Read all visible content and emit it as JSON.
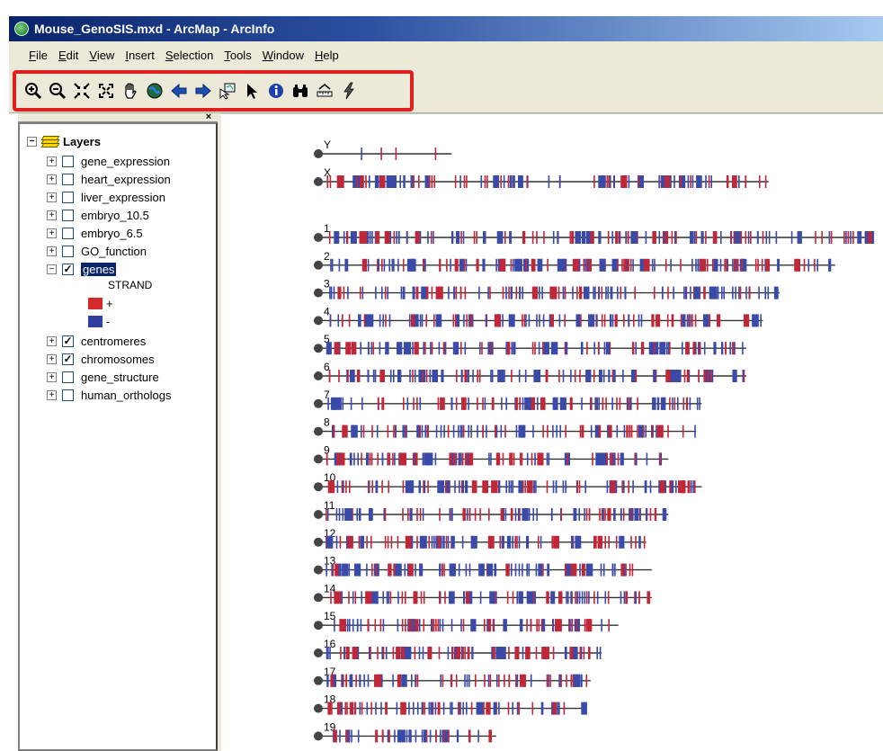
{
  "window": {
    "title": "Mouse_GenoSIS.mxd - ArcMap - ArcInfo"
  },
  "menu": [
    {
      "label": "File",
      "hot": "F"
    },
    {
      "label": "Edit",
      "hot": "E"
    },
    {
      "label": "View",
      "hot": "V"
    },
    {
      "label": "Insert",
      "hot": "I"
    },
    {
      "label": "Selection",
      "hot": "S"
    },
    {
      "label": "Tools",
      "hot": "T"
    },
    {
      "label": "Window",
      "hot": "W"
    },
    {
      "label": "Help",
      "hot": "H"
    }
  ],
  "toolbar": {
    "tools": [
      "zoom-in-icon",
      "zoom-out-icon",
      "fixed-zoom-in-icon",
      "fixed-zoom-out-icon",
      "pan-hand-icon",
      "full-extent-globe-icon",
      "back-arrow-icon",
      "forward-arrow-icon",
      "select-features-icon",
      "select-elements-icon",
      "identify-icon",
      "find-binoculars-icon",
      "measure-icon",
      "hyperlink-lightning-icon"
    ]
  },
  "toc": {
    "root_label": "Layers",
    "layers": [
      {
        "label": "gene_expression",
        "checked": false,
        "expanded": false
      },
      {
        "label": "heart_expression",
        "checked": false,
        "expanded": false
      },
      {
        "label": "liver_expression",
        "checked": false,
        "expanded": false
      },
      {
        "label": "embryo_10.5",
        "checked": false,
        "expanded": false
      },
      {
        "label": "embryo_6.5",
        "checked": false,
        "expanded": false
      },
      {
        "label": "GO_function",
        "checked": false,
        "expanded": false
      },
      {
        "label": "genes",
        "checked": true,
        "expanded": true,
        "selected": true
      },
      {
        "label": "centromeres",
        "checked": true,
        "expanded": false
      },
      {
        "label": "chromosomes",
        "checked": true,
        "expanded": false
      },
      {
        "label": "gene_structure",
        "checked": false,
        "expanded": false
      },
      {
        "label": "human_orthologs",
        "checked": false,
        "expanded": false
      }
    ],
    "legend": {
      "field": "STRAND",
      "classes": [
        {
          "label": "+",
          "color": "#d42a2a"
        },
        {
          "label": "-",
          "color": "#2f3fa0"
        }
      ]
    }
  },
  "map": {
    "colors": {
      "plus": "#c0283a",
      "minus": "#3a4aa8",
      "line": "#333333",
      "centromere": "#444444"
    },
    "chromosomes": [
      {
        "name": "Y",
        "length": 0.24
      },
      {
        "name": "X",
        "length": 0.81
      },
      {
        "name": "1",
        "length": 1.0
      },
      {
        "name": "2",
        "length": 0.93
      },
      {
        "name": "3",
        "length": 0.83
      },
      {
        "name": "4",
        "length": 0.8
      },
      {
        "name": "5",
        "length": 0.77
      },
      {
        "name": "6",
        "length": 0.77
      },
      {
        "name": "7",
        "length": 0.69
      },
      {
        "name": "8",
        "length": 0.68
      },
      {
        "name": "9",
        "length": 0.63
      },
      {
        "name": "10",
        "length": 0.69
      },
      {
        "name": "11",
        "length": 0.63
      },
      {
        "name": "12",
        "length": 0.59
      },
      {
        "name": "13",
        "length": 0.6
      },
      {
        "name": "14",
        "length": 0.6
      },
      {
        "name": "15",
        "length": 0.54
      },
      {
        "name": "16",
        "length": 0.51
      },
      {
        "name": "17",
        "length": 0.49
      },
      {
        "name": "18",
        "length": 0.48
      },
      {
        "name": "19",
        "length": 0.32
      }
    ]
  }
}
